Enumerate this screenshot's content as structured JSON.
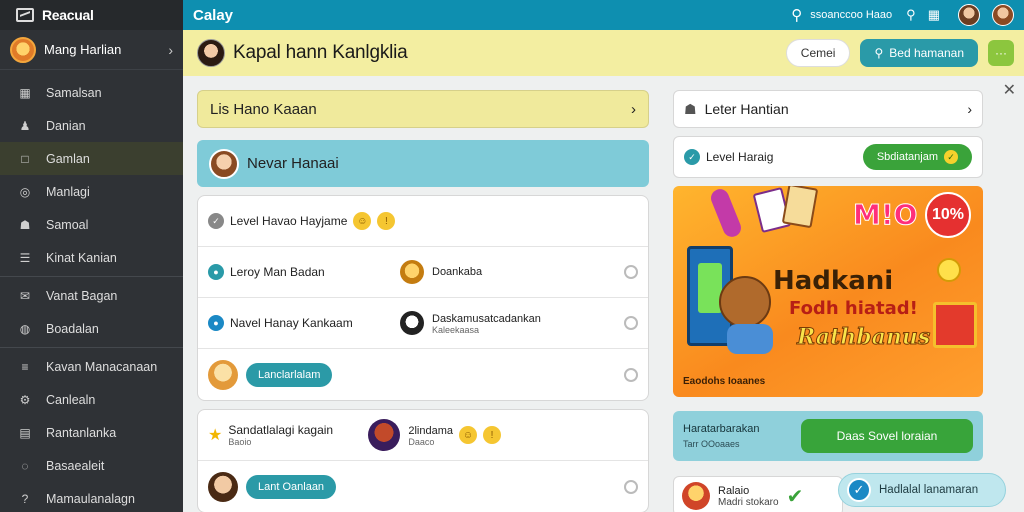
{
  "sidebar": {
    "brand": "Reacual",
    "user": {
      "name": "Mang Harlian"
    },
    "items": [
      {
        "label": "Samalsan",
        "icon": "grid-icon"
      },
      {
        "label": "Danian",
        "icon": "users-icon"
      },
      {
        "label": "Gamlan",
        "icon": "square-icon",
        "active": true
      },
      {
        "label": "Manlagi",
        "icon": "target-icon"
      },
      {
        "label": "Samoal",
        "icon": "person-icon"
      },
      {
        "label": "Kinat Kanian",
        "icon": "list-icon"
      },
      {
        "label": "Vanat Bagan",
        "icon": "mail-icon"
      },
      {
        "label": "Boadalan",
        "icon": "globe-icon"
      },
      {
        "label": "Kavan Manacanaan",
        "icon": "layers-icon"
      },
      {
        "label": "Canlealn",
        "icon": "gear-icon"
      },
      {
        "label": "Rantanlanka",
        "icon": "doc-icon"
      },
      {
        "label": "Basaealeit",
        "icon": "chat-icon"
      },
      {
        "label": "Mamaulanalagn",
        "icon": "help-icon"
      }
    ]
  },
  "topbar": {
    "title": "Calay",
    "label": "ssoanccoo Haao"
  },
  "subheader": {
    "heading": "Kapal hann Kanlgklia",
    "btn_white": "Cemei",
    "btn_teal": "Bed hamanan",
    "btn_more": "···"
  },
  "main": {
    "card_yellow": "Lis Hano Kaaan",
    "card_blue": "Nevar Hanaai",
    "group1": [
      {
        "label": "Level Havao Hayjame",
        "badge": "!"
      },
      {
        "label": "Leroy Man Badan",
        "right_label": "Doankaba"
      },
      {
        "label": "Navel Hanay Kankaam",
        "right_label": "Daskamusatcadankan",
        "right_sub": "Kaleekaasa"
      },
      {
        "button": "Lanclarlalam"
      }
    ],
    "group2": [
      {
        "label": "Sandatlalagi kagain",
        "sub": "Baoio",
        "right_label": "2lindama",
        "right_sub": "Daaco"
      },
      {
        "button": "Lant Oanlaan"
      }
    ]
  },
  "right": {
    "box1": "Leter Hantian",
    "box2": "Level Haraig",
    "box2_button": "Sbdiatanjam",
    "promo": {
      "badge": "10%",
      "word_top": "M!O",
      "title": "Hadkani",
      "subtitle": "Fodh hiatad!",
      "cta": "Rathbanus",
      "footer": "Eaodohs Ioaanes"
    },
    "info_line1": "Haratarbarakan",
    "info_line2": "Tarr OOoaaes",
    "info_button": "Daas Sovel loraian",
    "last_title": "Ralaio",
    "last_sub": "Madri stokaro"
  },
  "toast": "Hadlalal lanamaran"
}
